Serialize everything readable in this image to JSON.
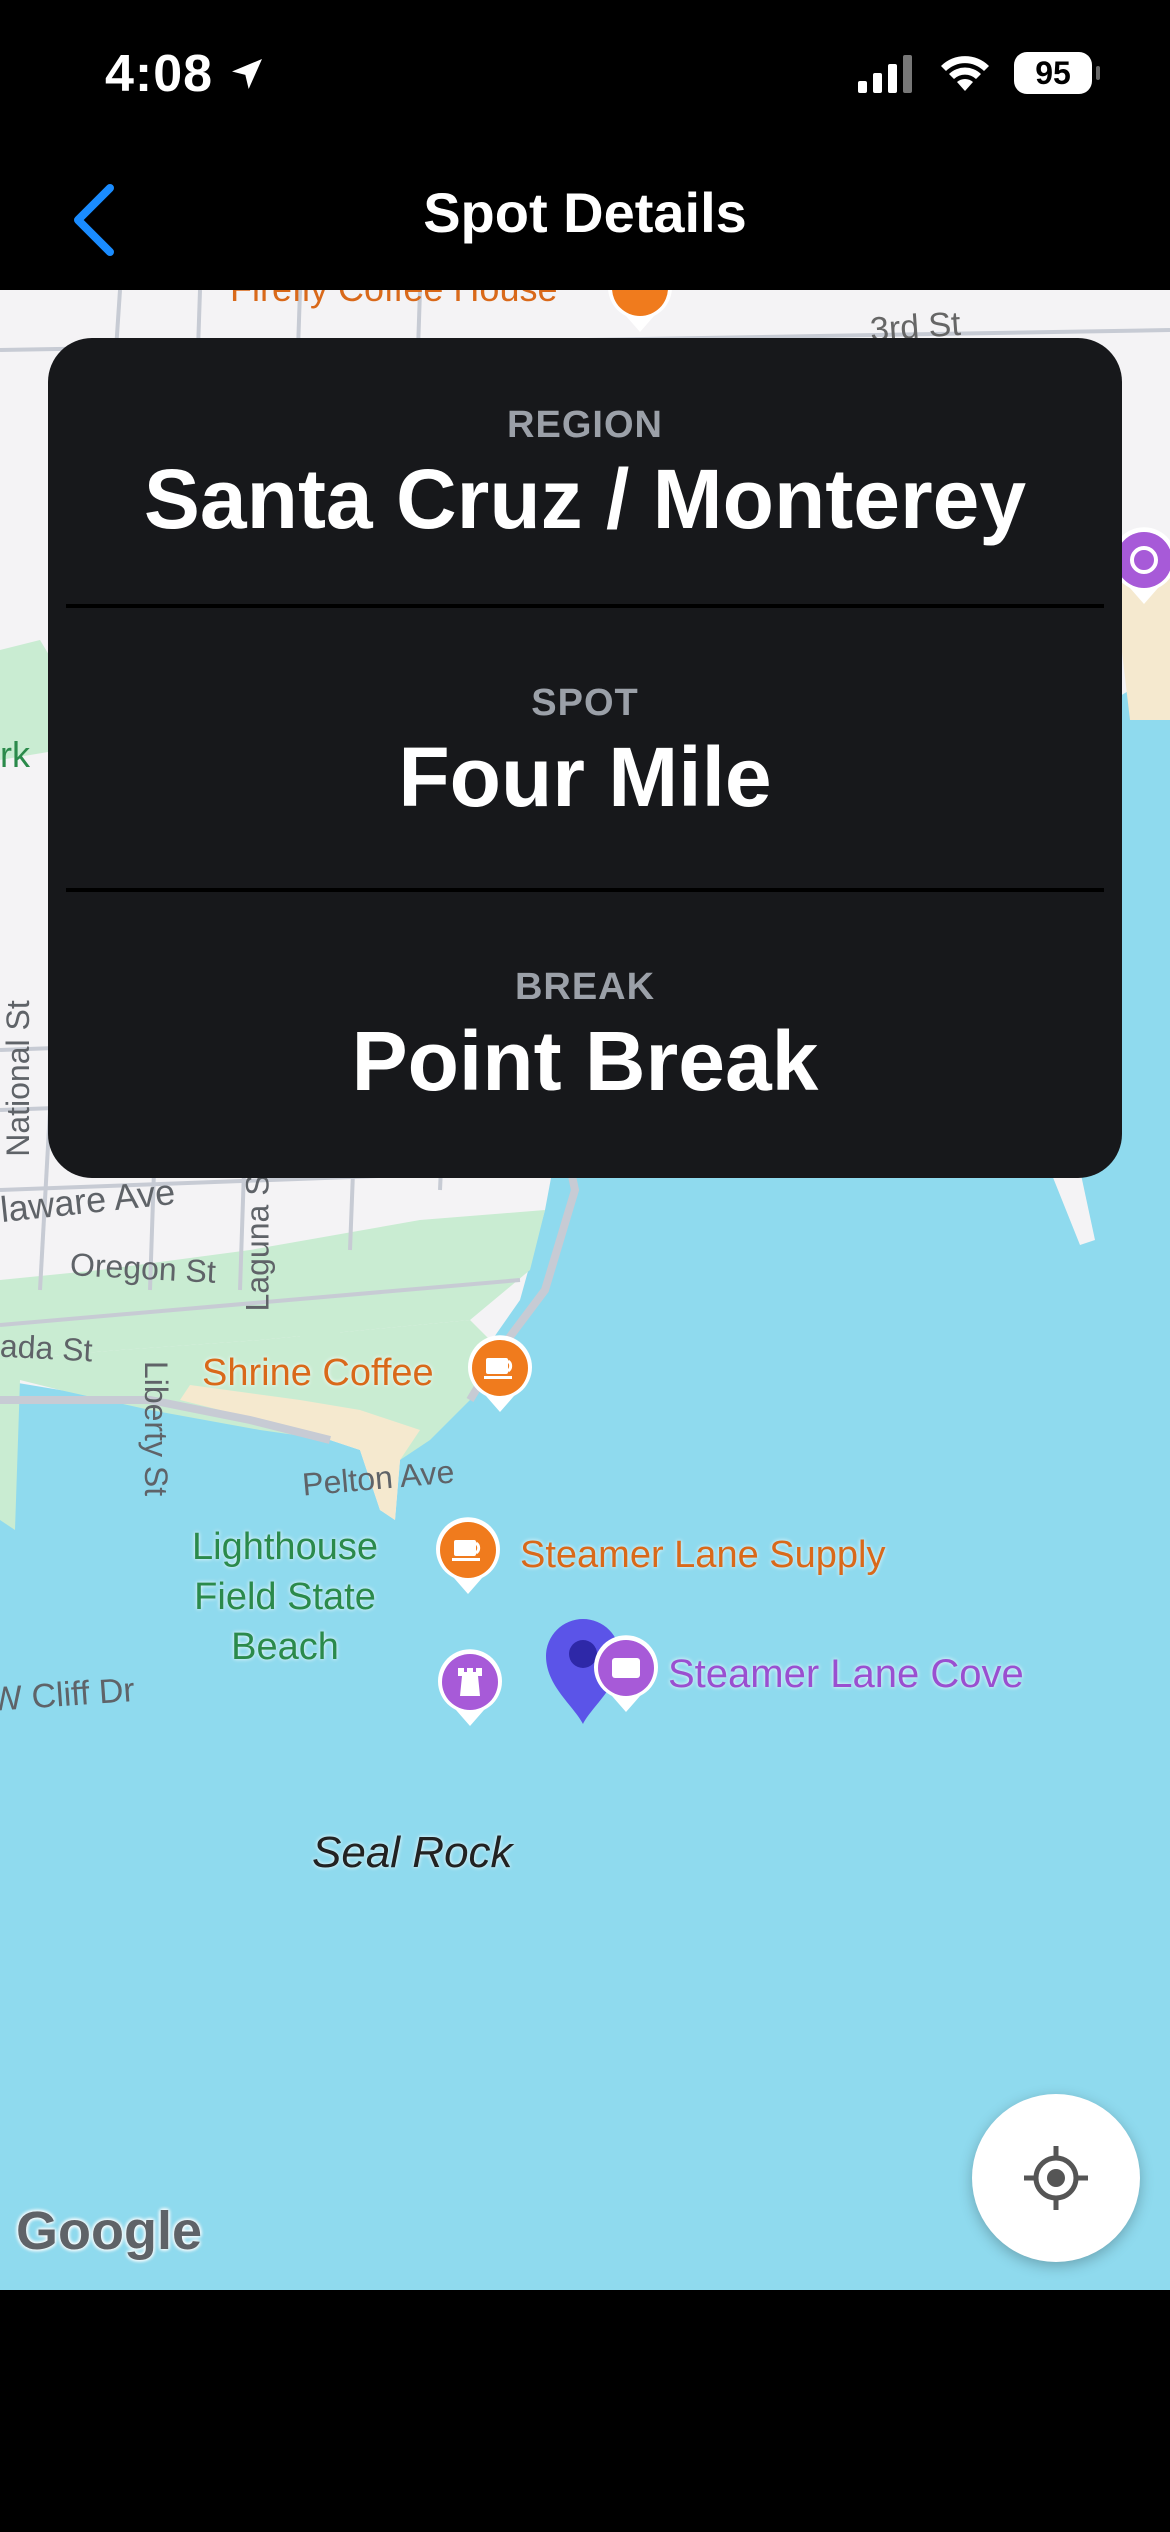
{
  "status": {
    "time": "4:08",
    "battery": "95",
    "location_icon": "location-arrow-icon",
    "signal_icon": "cellular-signal-icon",
    "wifi_icon": "wifi-icon"
  },
  "nav": {
    "title": "Spot Details",
    "back_icon": "chevron-left-icon",
    "accent": "#1a8cff"
  },
  "card": {
    "region": {
      "label": "REGION",
      "value": "Santa Cruz / Monterey"
    },
    "spot": {
      "label": "SPOT",
      "value": "Four Mile"
    },
    "break": {
      "label": "BREAK",
      "value": "Point Break"
    }
  },
  "map": {
    "streets": {
      "oregon": "Oregon St",
      "delaware": "laware Ave",
      "laguna": "Laguna St",
      "ada": "ada St",
      "liberty": "Liberty St",
      "pelton": "Pelton Ave",
      "cliff": "W Cliff Dr",
      "national": "National St",
      "third": "3rd St",
      "park": "rk",
      "top_partial": "Firefly Coffee House"
    },
    "places": {
      "shrine": "Shrine Coffee",
      "supply": "Steamer Lane Supply",
      "cove": "Steamer Lane Cove",
      "lighthouse": "Lighthouse Field State Beach",
      "seal_rock": "Seal Rock"
    },
    "attribution": "Google",
    "colors": {
      "water": "#8fdaee",
      "land": "#f4f3f5",
      "park": "#c9ecd2",
      "sand": "#f5e9cf",
      "coffee_pin": "#f07b1d",
      "purple_pin": "#a75ad8",
      "marker": "#5b54e8"
    }
  },
  "locate_icon": "crosshair-locate-icon"
}
